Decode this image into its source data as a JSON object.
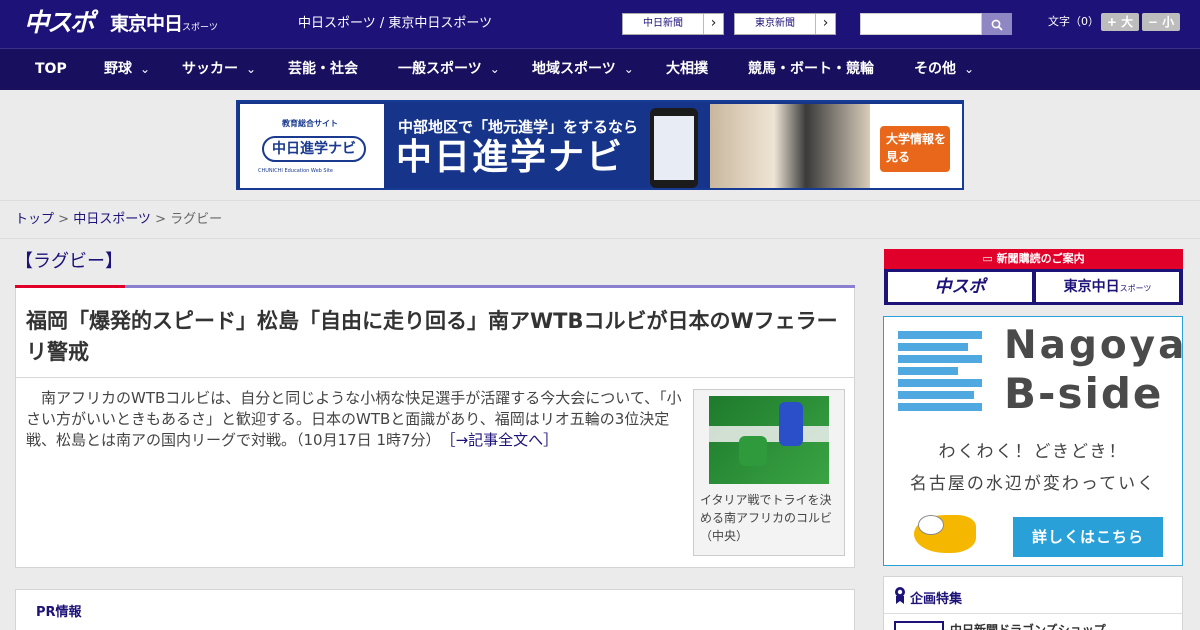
{
  "header": {
    "logo_chuspo": "中スポ",
    "logo_tokyo": "東京中日",
    "logo_tokyo_suffix": "スポーツ",
    "site_names": "中日スポーツ / 東京中日スポーツ",
    "link_chunichi": "中日新聞",
    "link_tokyo": "東京新聞",
    "arrow": "›",
    "search_placeholder": "",
    "search_icon": "magnifier-icon",
    "font_size_label": "文字（0）",
    "font_large": "+ 大",
    "font_small": "− 小"
  },
  "nav": {
    "items": [
      {
        "label": "TOP"
      },
      {
        "label": "野球",
        "dropdown": true
      },
      {
        "label": "サッカー",
        "dropdown": true
      },
      {
        "label": "芸能・社会"
      },
      {
        "label": "一般スポーツ",
        "dropdown": true
      },
      {
        "label": "地域スポーツ",
        "dropdown": true
      },
      {
        "label": "大相撲"
      },
      {
        "label": "競馬・ボート・競輪"
      },
      {
        "label": "その他",
        "dropdown": true
      }
    ],
    "chevron": "⌄"
  },
  "banner": {
    "small_label": "教育総合サイト",
    "logo": "中日進学ナビ",
    "logo_en": "CHUNICHI Education Web Site",
    "line1": "中部地区で「地元進学」をするなら",
    "line2": "中日進学ナビ",
    "cta": "大学情報を見る"
  },
  "breadcrumb": {
    "top": "トップ",
    "sep": " > ",
    "chuspo": "中日スポーツ",
    "current": "ラグビー"
  },
  "section": {
    "title": "【ラグビー】"
  },
  "article": {
    "title": "福岡「爆発的スピード」松島「自由に走り回る」南アWTBコルビが日本のWフェラーリ警戒",
    "body": "南アフリカのWTBコルビは、自分と同じような小柄な快足選手が活躍する今大会について、「小さい方がいいときもあるさ」と歓迎する。日本のWTBと面識があり、福岡はリオ五輪の3位決定戦、松島とは南アの国内リーグで対戦。（10月17日 1時7分）",
    "more_link": "［→記事全文へ］",
    "photo_caption": "イタリア戦でトライを決める南アフリカのコルビ（中央）"
  },
  "pr": {
    "title": "PR情報"
  },
  "sidebar": {
    "subscribe_header": "新聞購読のご案内",
    "subscribe_chuspo": "中スポ",
    "subscribe_tokyo": "東京中日",
    "subscribe_tokyo_suffix": "スポーツ",
    "ad_name1": "Nagoya",
    "ad_name2": "B-side",
    "ad_text1": "わくわく！どきどき！",
    "ad_text2": "名古屋の水辺が変わっていく",
    "ad_button": "詳しくはこちら",
    "kikaku_icon": "ribbon-icon",
    "kikaku_title": "企画特集",
    "kikaku_item": "中日新聞ドラゴンズショップ"
  },
  "colors": {
    "brand_navy": "#1c1278",
    "accent_red": "#e0002a",
    "link": "#1c1278",
    "ad_blue": "#2aa0d8"
  }
}
